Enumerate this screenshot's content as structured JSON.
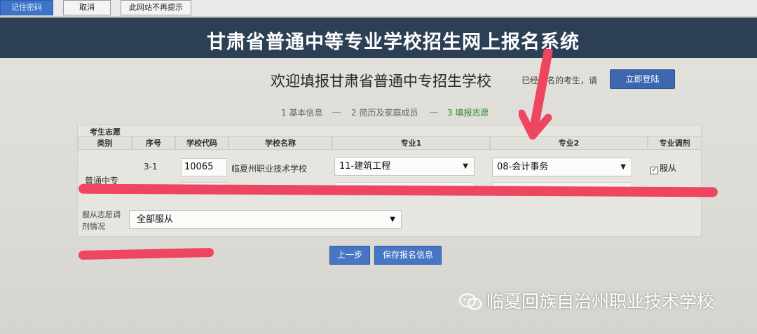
{
  "password_bar": {
    "remember_label": "记住密码",
    "cancel_label": "取消",
    "never_label": "此网站不再提示"
  },
  "banner": {
    "title": "甘肃省普通中等专业学校招生网上报名系统"
  },
  "header": {
    "welcome": "欢迎填报甘肃省普通中专招生学校",
    "registered_text": "已经报名的考生，请",
    "login_button": "立即登陆"
  },
  "steps": [
    {
      "label": "1 基本信息",
      "active": false
    },
    {
      "label": "2 简历及家庭成员",
      "active": false
    },
    {
      "label": "3 填报志愿",
      "active": true
    }
  ],
  "form": {
    "section_label": "考生志愿",
    "columns": [
      "类别",
      "序号",
      "学校代码",
      "学校名称",
      "专业1",
      "专业2",
      "专业调剂"
    ],
    "category": "普通中专",
    "rows": [
      {
        "seq": "3-1",
        "school_code": "10065",
        "school_name": "临夏州职业技术学校",
        "major1": "11-建筑工程",
        "major2": "08-会计事务",
        "adjust_label": "服从",
        "adjust_checked": true
      }
    ],
    "obey_label": "服从志愿调剂情况",
    "obey_value": "全部服从"
  },
  "buttons": {
    "prev": "上一步",
    "save": "保存报名信息"
  },
  "colors": {
    "banner": "#2d3f55",
    "button_blue": "#4676c4",
    "annotation_red": "#ee4560",
    "active_step": "#2f8a2f"
  },
  "watermark": {
    "text": "临夏回族自治州职业技术学校",
    "icon": "wechat-icon"
  }
}
